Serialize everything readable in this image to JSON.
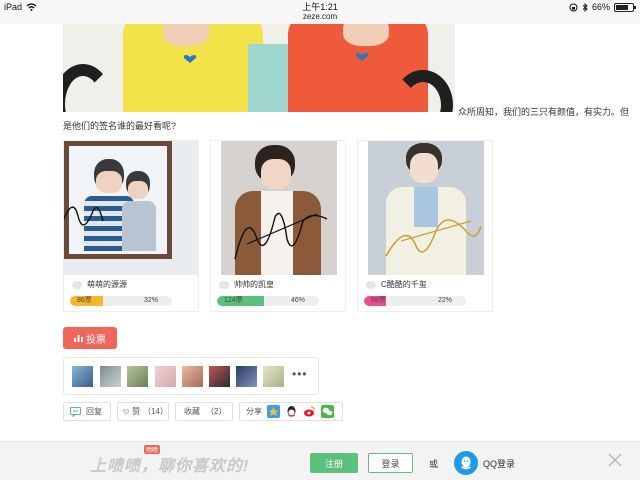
{
  "status_bar": {
    "device": "iPad",
    "time": "上午1:21",
    "url": "zeze.com",
    "battery": "66%"
  },
  "post": {
    "intro_line1": "众所周知，我们的三只有颜值，有实力。但",
    "intro_line2": "是他们的签名谁的最好看呢?"
  },
  "poll": {
    "options": [
      {
        "label": "萌萌的源源",
        "votes": "86票",
        "percent": "32%",
        "fill": 0.32,
        "color": "#f6b62e"
      },
      {
        "label": "帅帅的凯皇",
        "votes": "124票",
        "percent": "46%",
        "fill": 0.46,
        "color": "#5cc17c"
      },
      {
        "label": "C酷酷的千玺",
        "votes": "59票",
        "percent": "22%",
        "fill": 0.22,
        "color": "#ee4e8e"
      }
    ],
    "vote_button": "投票"
  },
  "actions": {
    "reply": "回复",
    "like": "赞",
    "like_count": "（14）",
    "favorite": "收藏",
    "favorite_count": "（2）",
    "share": "分享"
  },
  "footer": {
    "slogan": "上啧啧，聊你喜欢的!",
    "badge": "啧啧",
    "register": "注册",
    "login": "登录",
    "or": "或",
    "qq_login": "QQ登录"
  },
  "colors": {
    "accent_red": "#f0665a",
    "accent_green": "#5cc17c",
    "qq_blue": "#1e9be7"
  }
}
